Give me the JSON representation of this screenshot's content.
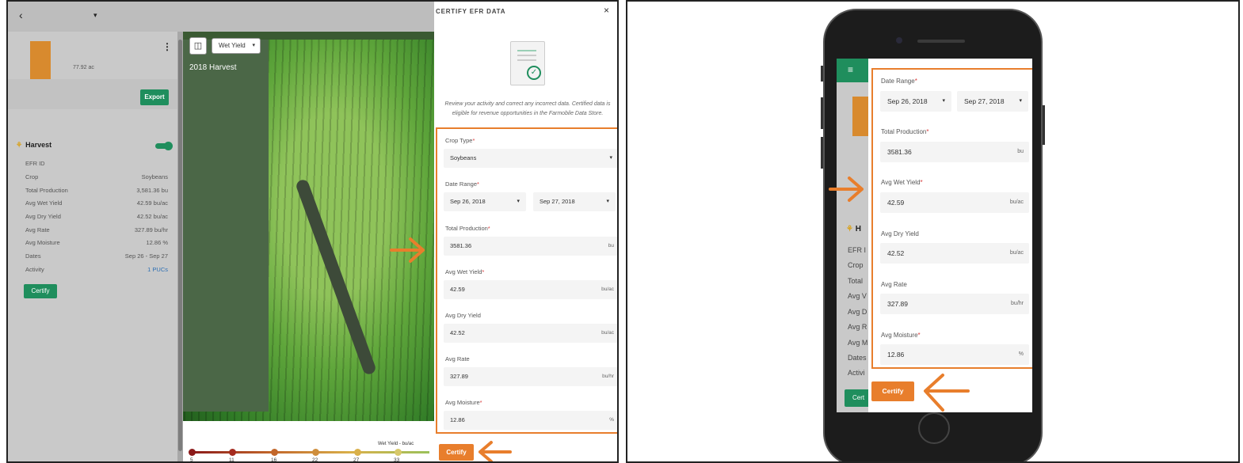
{
  "left": {
    "topbar": {
      "back_glyph": "‹",
      "caret_glyph": "▾"
    },
    "field": {
      "acres": "77.92 ac",
      "menu_glyph": "⋮"
    },
    "export_label": "Export",
    "harvest": {
      "title": "Harvest",
      "icon": "wheat-icon"
    },
    "attributes": [
      {
        "label": "EFR ID",
        "value": ""
      },
      {
        "label": "Crop",
        "value": "Soybeans"
      },
      {
        "label": "Total Production",
        "value": "3,581.36 bu"
      },
      {
        "label": "Avg Wet Yield",
        "value": "42.59 bu/ac"
      },
      {
        "label": "Avg Dry Yield",
        "value": "42.52 bu/ac"
      },
      {
        "label": "Avg Rate",
        "value": "327.89 bu/hr"
      },
      {
        "label": "Avg Moisture",
        "value": "12.86 %"
      },
      {
        "label": "Dates",
        "value": "Sep 26 - Sep 27"
      },
      {
        "label": "Activity",
        "value": "1 PUCs"
      }
    ],
    "certify_label": "Certify",
    "map": {
      "layer_select": "Wet Yield",
      "label": "2018 Harvest"
    },
    "legend": {
      "title": "Wet Yield - bu/ac",
      "ticks": [
        "5",
        "11",
        "16",
        "22",
        "27",
        "33"
      ]
    }
  },
  "panel": {
    "title": "CERTIFY EFR DATA",
    "close_glyph": "×",
    "description": "Review your activity and correct any incorrect data. Certified data is eligible for revenue opportunities in the Farmobile Data Store.",
    "crop_type_label": "Crop Type",
    "crop_type_value": "Soybeans",
    "date_range_label": "Date Range",
    "date_start": "Sep 26, 2018",
    "date_end": "Sep 27, 2018",
    "total_production_label": "Total Production",
    "total_production_value": "3581.36",
    "total_production_unit": "bu",
    "wet_yield_label": "Avg Wet Yield",
    "wet_yield_value": "42.59",
    "wet_yield_unit": "bu/ac",
    "dry_yield_label": "Avg Dry Yield",
    "dry_yield_value": "42.52",
    "dry_yield_unit": "bu/ac",
    "rate_label": "Avg Rate",
    "rate_value": "327.89",
    "rate_unit": "bu/hr",
    "moisture_label": "Avg Moisture",
    "moisture_value": "12.86",
    "moisture_unit": "%",
    "required_mark": "*",
    "certify_label": "Certify"
  },
  "phone": {
    "menu_glyph": "≡",
    "side_heading": "H",
    "side_labels": [
      "EFR I",
      "Crop",
      "Total",
      "Avg V",
      "Avg D",
      "Avg R",
      "Avg M",
      "Dates",
      "Activi"
    ],
    "side_certify": "Cert",
    "date_range_label": "Date Range",
    "date_start": "Sep 26, 2018",
    "date_end": "Sep 27, 2018",
    "total_production_label": "Total Production",
    "total_production_value": "3581.36",
    "total_production_unit": "bu",
    "wet_yield_label": "Avg Wet Yield",
    "wet_yield_value": "42.59",
    "wet_yield_unit": "bu/ac",
    "dry_yield_label": "Avg Dry Yield",
    "dry_yield_value": "42.52",
    "dry_yield_unit": "bu/ac",
    "rate_label": "Avg Rate",
    "rate_value": "327.89",
    "rate_unit": "bu/hr",
    "moisture_label": "Avg Moisture",
    "moisture_value": "12.86",
    "moisture_unit": "%",
    "required_mark": "*",
    "certify_label": "Certify"
  },
  "colors": {
    "accent_orange": "#e87e2c",
    "brand_green": "#1f8e5d",
    "required_red": "#d83b3b"
  }
}
